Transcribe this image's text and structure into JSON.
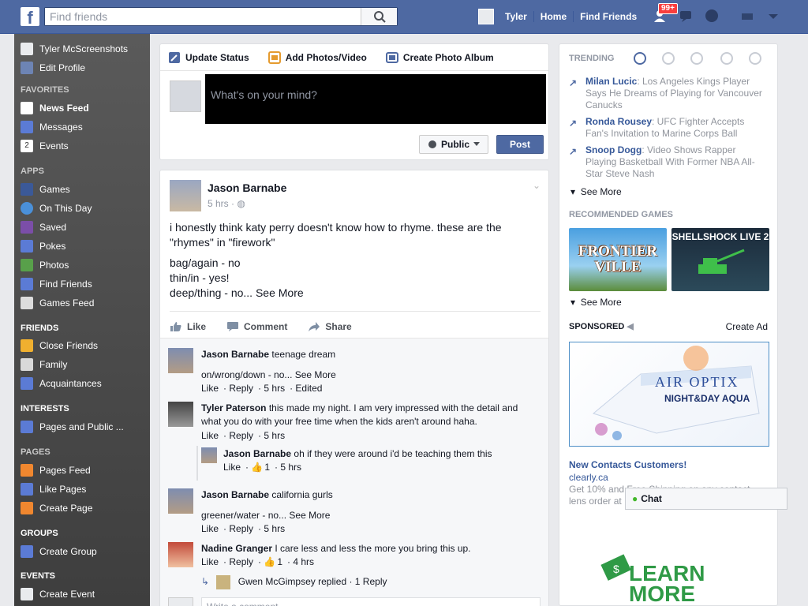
{
  "topbar": {
    "logo": "f",
    "search_placeholder": "Find friends",
    "user_name": "Tyler",
    "home": "Home",
    "find_friends": "Find Friends",
    "friend_requests_badge": "99+"
  },
  "leftnav": {
    "profile_name": "Tyler McScreenshots",
    "edit_profile": "Edit Profile",
    "favorites_head": "FAVORITES",
    "favorites": [
      "News Feed",
      "Messages",
      "Events"
    ],
    "events_count": "2",
    "apps_head": "APPS",
    "apps": [
      "Games",
      "On This Day",
      "Saved",
      "Pokes",
      "Photos",
      "Find Friends",
      "Games Feed"
    ],
    "friends_head": "FRIENDS",
    "friends": [
      "Close Friends",
      "Family",
      "Acquaintances"
    ],
    "interests_head": "INTERESTS",
    "interests": [
      "Pages and Public ..."
    ],
    "pages_head": "PAGES",
    "pages": [
      "Pages Feed",
      "Like Pages",
      "Create Page"
    ],
    "groups_head": "GROUPS",
    "groups": [
      "Create Group"
    ],
    "events_head": "EVENTS",
    "events": [
      "Create Event"
    ]
  },
  "composer": {
    "tab_status": "Update Status",
    "tab_photos": "Add Photos/Video",
    "tab_album": "Create Photo Album",
    "placeholder": "What's on your mind?",
    "audience": "Public",
    "post": "Post"
  },
  "post": {
    "author": "Jason Barnabe",
    "time": "5 hrs",
    "body_line1": "i honestly think katy perry doesn't know how to rhyme. these are the \"rhymes\" in \"firework\"",
    "body_line2": "bag/again - no",
    "body_line3": "thin/in - yes!",
    "body_line4": "deep/thing - no...",
    "see_more": "See More",
    "like": "Like",
    "comment": "Comment",
    "share": "Share",
    "comments": [
      {
        "name": "Jason Barnabe",
        "text": "teenage dream",
        "extra": "on/wrong/down - no...",
        "see_more": "See More",
        "like": "Like",
        "reply": "Reply",
        "time": "5 hrs",
        "edited": "Edited"
      },
      {
        "name": "Tyler Paterson",
        "text": "this made my night. I am very impressed with the detail and what you do with your free time when the kids aren't around haha.",
        "like": "Like",
        "reply": "Reply",
        "time": "5 hrs"
      },
      {
        "name": "Jason Barnabe",
        "text": "oh if they were around i'd be teaching them this",
        "like": "Like",
        "likes": "1",
        "time": "5 hrs"
      },
      {
        "name": "Jason Barnabe",
        "text": "california gurls",
        "extra": "greener/water - no...",
        "see_more": "See More",
        "like": "Like",
        "reply": "Reply",
        "time": "5 hrs"
      },
      {
        "name": "Nadine Granger",
        "text": "I care less and less the more you bring this up.",
        "like": "Like",
        "reply": "Reply",
        "likes": "1",
        "time": "4 hrs"
      }
    ],
    "replied_text": "Gwen McGimpsey replied · 1 Reply",
    "write_comment": "Write a comment..."
  },
  "rightcol": {
    "trending_head": "TRENDING",
    "trends": [
      {
        "name": "Milan Lucic",
        "text": ": Los Angeles Kings Player Says He Dreams of Playing for Vancouver Canucks"
      },
      {
        "name": "Ronda Rousey",
        "text": ": UFC Fighter Accepts Fan's Invitation to Marine Corps Ball"
      },
      {
        "name": "Snoop Dogg",
        "text": ": Video Shows Rapper Playing Basketball With Former NBA All-Star Steve Nash"
      }
    ],
    "see_more": "See More",
    "games_head": "RECOMMENDED GAMES",
    "game1": "FRONTIER VILLE",
    "game2": "SHELLSHOCK LIVE 2",
    "sponsored_head": "SPONSORED",
    "create_ad": "Create Ad",
    "ad_brand_line1": "AIR OPTIX",
    "ad_brand_line2": "NIGHT&DAY AQUA",
    "ad_title": "New Contacts Customers!",
    "ad_site": "clearly.ca",
    "ad_text": "Get 10% and Free Shipping on any contact lens order at",
    "ad2_text": "LEARN MORE"
  },
  "chat": {
    "label": "Chat"
  },
  "colors": {
    "brand": "#4e69a2",
    "link": "#365899"
  }
}
